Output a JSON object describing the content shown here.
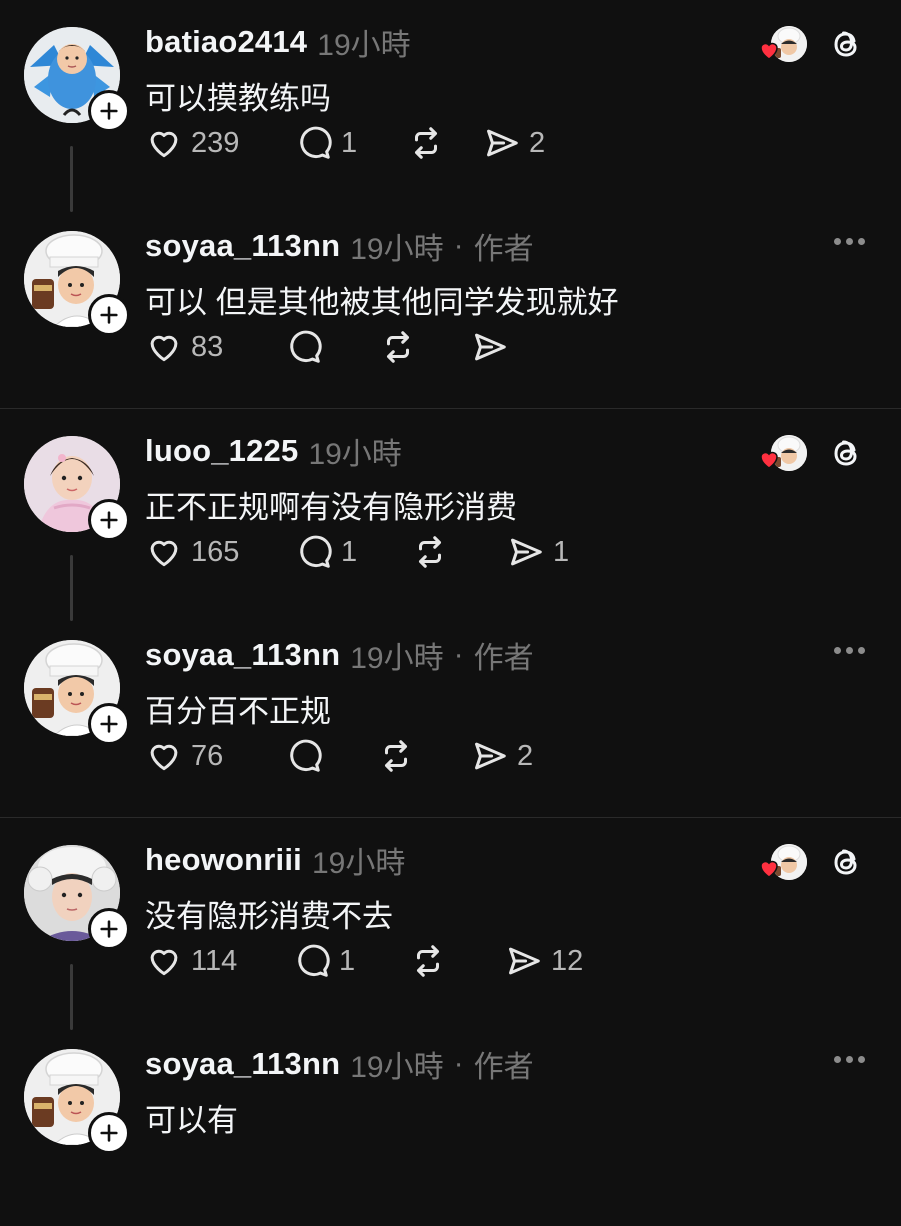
{
  "threads": [
    {
      "comment": {
        "username": "batiao2414",
        "time": "19小時",
        "text": "可以摸教练吗",
        "likes": "239",
        "replies": "1",
        "shares": "2"
      },
      "reply": {
        "username": "soyaa_113nn",
        "time": "19小時",
        "author_tag": "作者",
        "text": "可以 但是其他被其他同学发现就好",
        "likes": "83",
        "replies": "",
        "shares": ""
      }
    },
    {
      "comment": {
        "username": "luoo_1225",
        "time": "19小時",
        "text": "正不正规啊有没有隐形消费",
        "likes": "165",
        "replies": "1",
        "shares": "1"
      },
      "reply": {
        "username": "soyaa_113nn",
        "time": "19小時",
        "author_tag": "作者",
        "text": "百分百不正规",
        "likes": "76",
        "replies": "",
        "shares": "2"
      }
    },
    {
      "comment": {
        "username": "heowonriii",
        "time": "19小時",
        "text": "没有隐形消费不去",
        "likes": "114",
        "replies": "1",
        "shares": "12"
      },
      "reply": {
        "username": "soyaa_113nn",
        "time": "19小時",
        "author_tag": "作者",
        "text": "可以有",
        "likes": "",
        "replies": "",
        "shares": ""
      }
    }
  ],
  "sep_char": "·",
  "icons": {
    "like": "heart-outline-icon",
    "reply": "speech-bubble-icon",
    "repost": "repost-arrows-icon",
    "share": "paper-plane-icon",
    "follow": "plus-icon",
    "liked_by_author": "red-heart-icon",
    "app": "threads-logo-icon",
    "menu": "more-dots-icon"
  },
  "colors": {
    "background": "#101010",
    "text": "#f3f5f7",
    "muted": "#777777",
    "heart": "#ff3040"
  }
}
